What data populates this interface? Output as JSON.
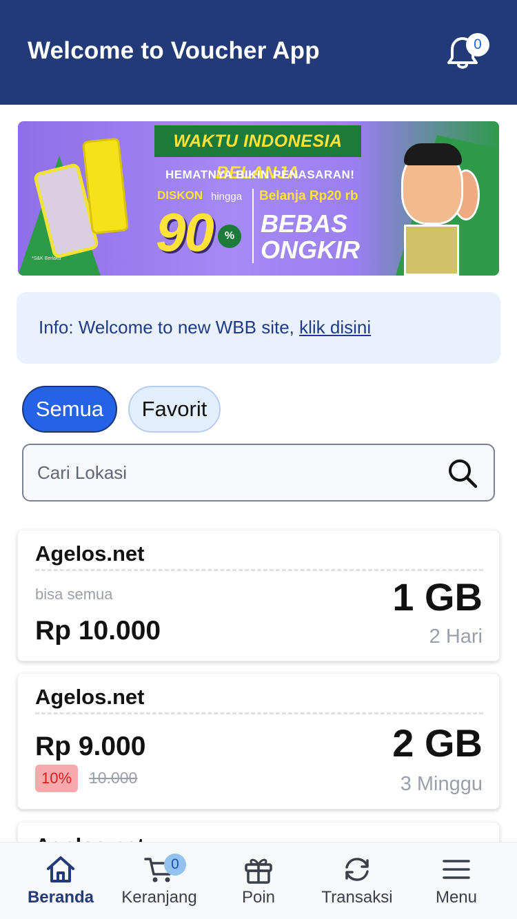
{
  "header": {
    "title": "Welcome to Voucher App",
    "notification_count": "0"
  },
  "banner": {
    "headline": "WAKTU INDONESIA BELANJA",
    "subtitle": "HEMATNYA BIKIN PENASARAN!",
    "discount_label": "DISKON",
    "discount_hingga": "hingga",
    "discount_value": "90",
    "discount_percent": "%",
    "belanja_label": "Belanja Rp20 rb",
    "shipping_label": "BEBAS ONGKIR",
    "footnote": "*S&K Berlaku"
  },
  "info": {
    "text": "Info: Welcome to new WBB site, ",
    "link": "klik disini"
  },
  "filters": {
    "all": "Semua",
    "favorite": "Favorit"
  },
  "search": {
    "placeholder": "Cari Lokasi"
  },
  "vouchers": [
    {
      "name": "Agelos.net",
      "note": "bisa semua",
      "price": "Rp 10.000",
      "quota": "1 GB",
      "duration": "2 Hari"
    },
    {
      "name": "Agelos.net",
      "price": "Rp 9.000",
      "discount": "10%",
      "old_price": "10.000",
      "quota": "2 GB",
      "duration": "3 Minggu"
    },
    {
      "name": "Agelos.net"
    }
  ],
  "nav": {
    "items": [
      {
        "label": "Beranda",
        "icon": "home-icon",
        "active": true
      },
      {
        "label": "Keranjang",
        "icon": "cart-icon",
        "badge": "0"
      },
      {
        "label": "Poin",
        "icon": "gift-icon"
      },
      {
        "label": "Transaksi",
        "icon": "refresh-icon"
      },
      {
        "label": "Menu",
        "icon": "hamburger-menu-icon"
      }
    ]
  },
  "colors": {
    "header_bg": "#233a78",
    "primary": "#2563e6",
    "info_bg": "#e8f1fd",
    "discount_bg": "#f8a9ab",
    "discount_text": "#d81e1e"
  }
}
